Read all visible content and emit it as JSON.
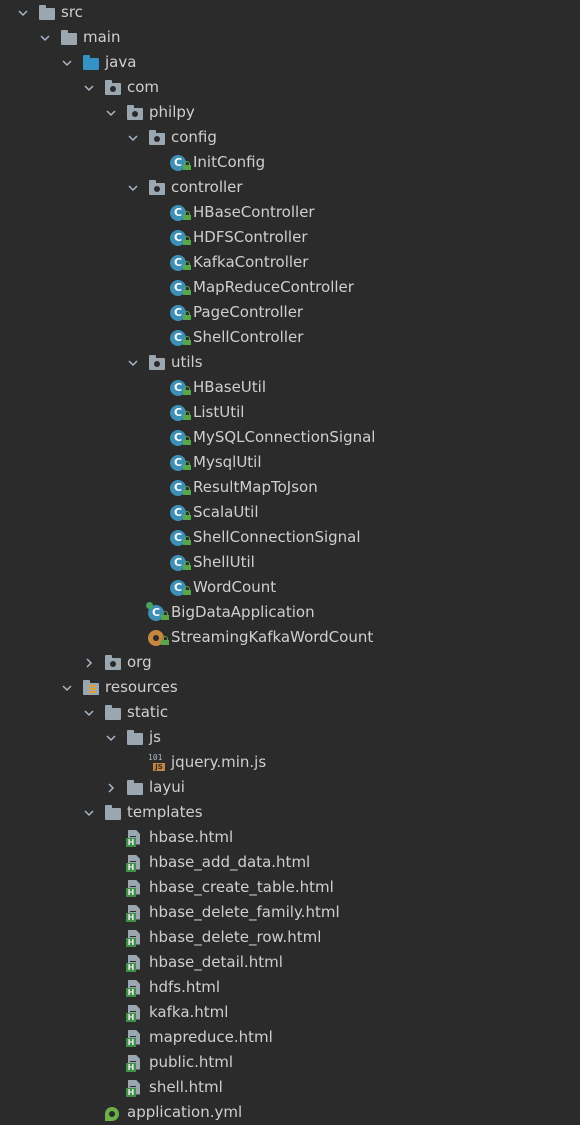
{
  "tree": [
    {
      "label": "src",
      "depth": 0,
      "arrow": "down",
      "icon": "folder"
    },
    {
      "label": "main",
      "depth": 1,
      "arrow": "down",
      "icon": "folder"
    },
    {
      "label": "java",
      "depth": 2,
      "arrow": "down",
      "icon": "source-folder"
    },
    {
      "label": "com",
      "depth": 3,
      "arrow": "down",
      "icon": "package"
    },
    {
      "label": "philpy",
      "depth": 4,
      "arrow": "down",
      "icon": "package"
    },
    {
      "label": "config",
      "depth": 5,
      "arrow": "down",
      "icon": "package"
    },
    {
      "label": "InitConfig",
      "depth": 6,
      "arrow": "none",
      "icon": "class"
    },
    {
      "label": "controller",
      "depth": 5,
      "arrow": "down",
      "icon": "package"
    },
    {
      "label": "HBaseController",
      "depth": 6,
      "arrow": "none",
      "icon": "class"
    },
    {
      "label": "HDFSController",
      "depth": 6,
      "arrow": "none",
      "icon": "class"
    },
    {
      "label": "KafkaController",
      "depth": 6,
      "arrow": "none",
      "icon": "class"
    },
    {
      "label": "MapReduceController",
      "depth": 6,
      "arrow": "none",
      "icon": "class"
    },
    {
      "label": "PageController",
      "depth": 6,
      "arrow": "none",
      "icon": "class"
    },
    {
      "label": "ShellController",
      "depth": 6,
      "arrow": "none",
      "icon": "class"
    },
    {
      "label": "utils",
      "depth": 5,
      "arrow": "down",
      "icon": "package"
    },
    {
      "label": "HBaseUtil",
      "depth": 6,
      "arrow": "none",
      "icon": "class"
    },
    {
      "label": "ListUtil",
      "depth": 6,
      "arrow": "none",
      "icon": "class"
    },
    {
      "label": "MySQLConnectionSignal",
      "depth": 6,
      "arrow": "none",
      "icon": "class"
    },
    {
      "label": "MysqlUtil",
      "depth": 6,
      "arrow": "none",
      "icon": "class"
    },
    {
      "label": "ResultMapToJson",
      "depth": 6,
      "arrow": "none",
      "icon": "class"
    },
    {
      "label": "ScalaUtil",
      "depth": 6,
      "arrow": "none",
      "icon": "class"
    },
    {
      "label": "ShellConnectionSignal",
      "depth": 6,
      "arrow": "none",
      "icon": "class"
    },
    {
      "label": "ShellUtil",
      "depth": 6,
      "arrow": "none",
      "icon": "class"
    },
    {
      "label": "WordCount",
      "depth": 6,
      "arrow": "none",
      "icon": "class"
    },
    {
      "label": "BigDataApplication",
      "depth": 5,
      "arrow": "none",
      "icon": "spring-boot-class"
    },
    {
      "label": "StreamingKafkaWordCount",
      "depth": 5,
      "arrow": "none",
      "icon": "scala-object"
    },
    {
      "label": "org",
      "depth": 3,
      "arrow": "right",
      "icon": "package"
    },
    {
      "label": "resources",
      "depth": 2,
      "arrow": "down",
      "icon": "resources-folder"
    },
    {
      "label": "static",
      "depth": 3,
      "arrow": "down",
      "icon": "folder"
    },
    {
      "label": "js",
      "depth": 4,
      "arrow": "down",
      "icon": "folder"
    },
    {
      "label": "jquery.min.js",
      "depth": 5,
      "arrow": "none",
      "icon": "js-file"
    },
    {
      "label": "layui",
      "depth": 4,
      "arrow": "right",
      "icon": "folder"
    },
    {
      "label": "templates",
      "depth": 3,
      "arrow": "down",
      "icon": "folder"
    },
    {
      "label": "hbase.html",
      "depth": 4,
      "arrow": "none",
      "icon": "html-file"
    },
    {
      "label": "hbase_add_data.html",
      "depth": 4,
      "arrow": "none",
      "icon": "html-file"
    },
    {
      "label": "hbase_create_table.html",
      "depth": 4,
      "arrow": "none",
      "icon": "html-file"
    },
    {
      "label": "hbase_delete_family.html",
      "depth": 4,
      "arrow": "none",
      "icon": "html-file"
    },
    {
      "label": "hbase_delete_row.html",
      "depth": 4,
      "arrow": "none",
      "icon": "html-file"
    },
    {
      "label": "hbase_detail.html",
      "depth": 4,
      "arrow": "none",
      "icon": "html-file"
    },
    {
      "label": "hdfs.html",
      "depth": 4,
      "arrow": "none",
      "icon": "html-file"
    },
    {
      "label": "kafka.html",
      "depth": 4,
      "arrow": "none",
      "icon": "html-file"
    },
    {
      "label": "mapreduce.html",
      "depth": 4,
      "arrow": "none",
      "icon": "html-file"
    },
    {
      "label": "public.html",
      "depth": 4,
      "arrow": "none",
      "icon": "html-file"
    },
    {
      "label": "shell.html",
      "depth": 4,
      "arrow": "none",
      "icon": "html-file"
    },
    {
      "label": "application.yml",
      "depth": 3,
      "arrow": "none",
      "icon": "yaml-file"
    }
  ],
  "colors": {
    "background": "#2b2b2b",
    "text": "#cfcfcf",
    "source_folder": "#3592c4",
    "class_icon": "#3d8fb5",
    "lock": "#57a64a",
    "scala_object": "#c7863f",
    "html_badge": "#3f8f49"
  }
}
